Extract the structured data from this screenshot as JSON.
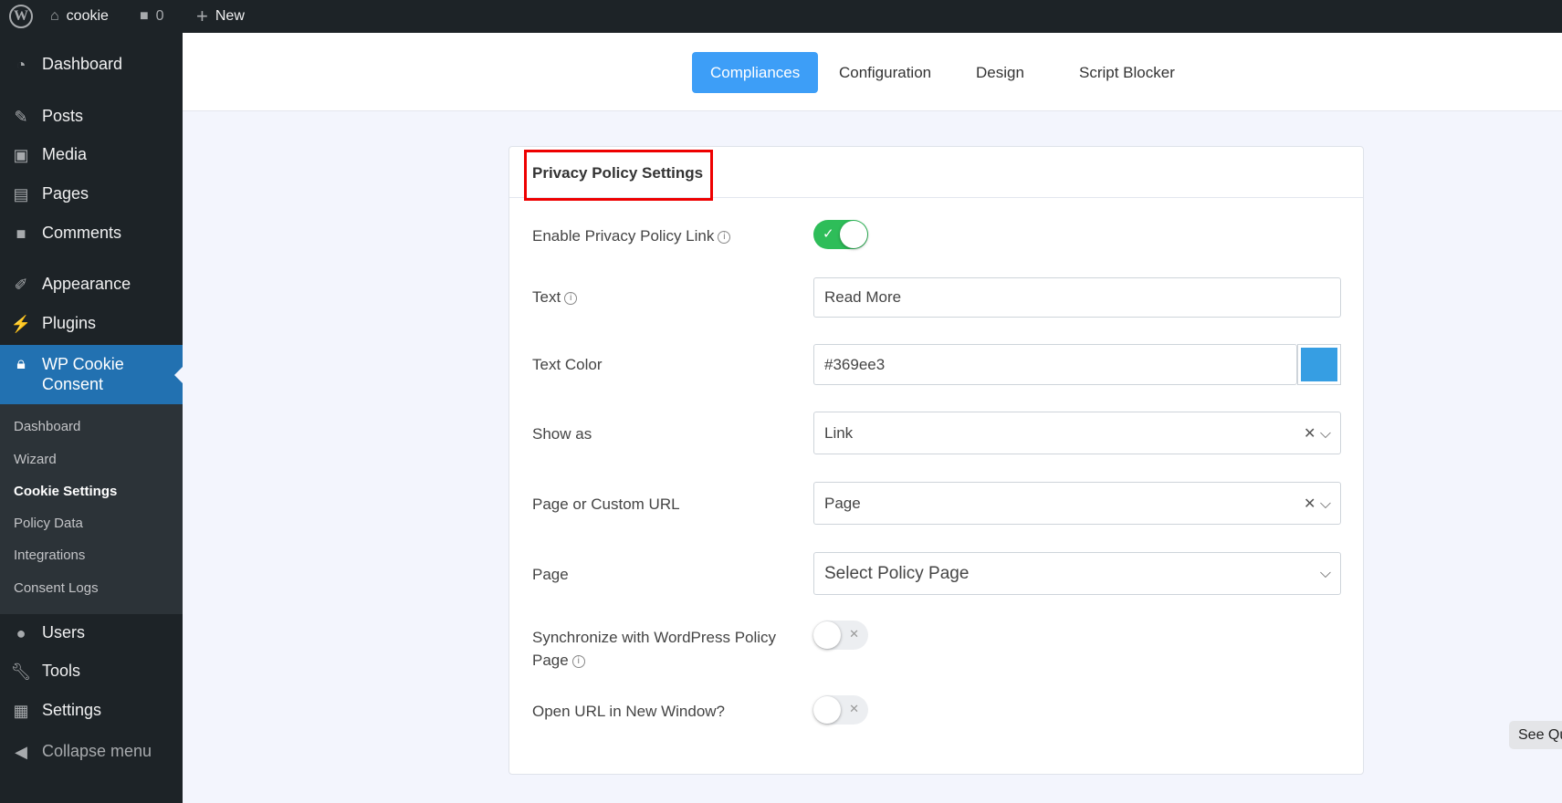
{
  "topbar": {
    "site": "cookie",
    "comments": "0",
    "new": "New"
  },
  "sidebar": {
    "items": [
      "Dashboard",
      "Posts",
      "Media",
      "Pages",
      "Comments",
      "Appearance",
      "Plugins"
    ],
    "active": "WP Cookie Consent",
    "sub": [
      "Dashboard",
      "Wizard",
      "Cookie Settings",
      "Policy Data",
      "Integrations",
      "Consent Logs"
    ],
    "items2": [
      "Users",
      "Tools",
      "Settings"
    ],
    "collapse": "Collapse menu"
  },
  "tabs": [
    "Compliances",
    "Configuration",
    "Design",
    "Script Blocker"
  ],
  "card": {
    "title": "Privacy Policy Settings",
    "enable_label": "Enable Privacy Policy Link",
    "enable_on": true,
    "text_label": "Text",
    "text_value": "Read More",
    "color_label": "Text Color",
    "color_value": "#369ee3",
    "show_label": "Show as",
    "show_value": "Link",
    "url_label": "Page or Custom URL",
    "url_value": "Page",
    "page_label": "Page",
    "page_value": "Select Policy Page",
    "sync_label": "Synchronize with WordPress Policy Page",
    "sync_on": false,
    "open_label": "Open URL in New Window?",
    "open_on": false
  },
  "see_button": "See Qu"
}
